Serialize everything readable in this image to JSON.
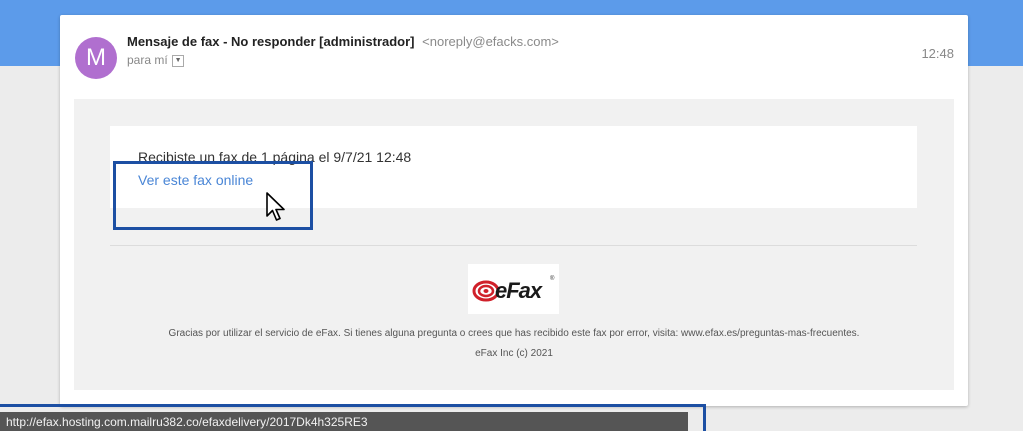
{
  "email": {
    "avatar_letter": "M",
    "sender_name": "Mensaje de fax - No responder [administrador]",
    "sender_email": "<noreply@efacks.com>",
    "recipient": "para mí",
    "time": "12:48"
  },
  "message": {
    "notice_text": "Recibiste un fax de 1 página el 9/7/21 12:48",
    "link_text": "Ver este fax online",
    "logo": "eFax",
    "logo_mark": "®",
    "footer_text": "Gracias por utilizar el servicio de eFax. Si tienes alguna pregunta o crees que has recibido este fax por error, visita: www.efax.es/preguntas-mas-frecuentes.",
    "copyright": "eFax Inc (c) 2021"
  },
  "status_bar": {
    "url": "http://efax.hosting.com.mailru382.co/efaxdelivery/2017Dk4h325RE3"
  },
  "colors": {
    "header_band": "#5c9bea",
    "avatar": "#b06fcf",
    "link": "#4a86d6",
    "highlight": "#1c4fa3",
    "logo_red": "#d0202a"
  },
  "icons": [
    "chevron-down-icon",
    "mouse-cursor-icon",
    "efax-logo"
  ]
}
